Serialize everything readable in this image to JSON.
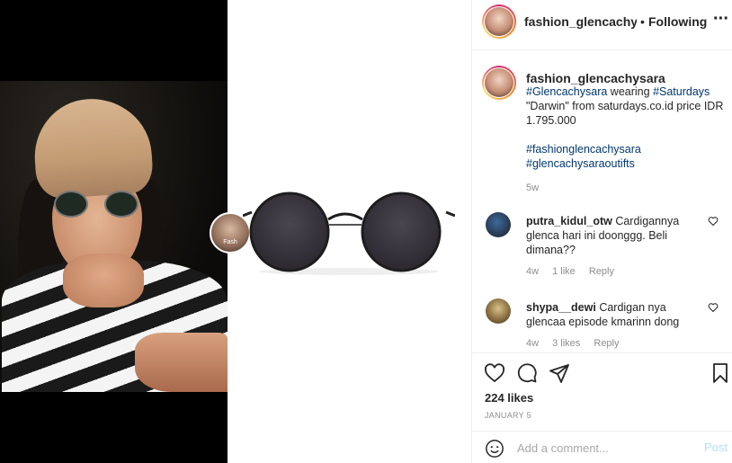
{
  "post": {
    "username": "fashion_glencachysara",
    "header_username": "fashion_glencachysara",
    "separator": "•",
    "follow_label": "Following",
    "more_label": "···",
    "tag_label": "Fash"
  },
  "caption": {
    "username": "fashion_glencachysara",
    "tag1": "#Glencachysara",
    "text1": " wearing ",
    "tag2": "#Saturdays",
    "text2": " \"Darwin\" from saturdays.co.id price IDR 1.795.000",
    "tag3": "#fashionglencachysara",
    "tag4": "#glencachysaraoutifts",
    "age": "5w"
  },
  "comments": [
    {
      "username": "putra_kidul_otw",
      "text": "Cardigannya glenca hari ini doonggg. Beli dimana??",
      "age": "4w",
      "likes": "1 like",
      "reply": "Reply"
    },
    {
      "username": "shypa__dewi",
      "text": "Cardigan nya glencaa episode kmarinn dong",
      "age": "4w",
      "likes": "3 likes",
      "reply": "Reply"
    }
  ],
  "actions": {
    "likes": "224 likes",
    "date": "JANUARY 5"
  },
  "add_comment": {
    "placeholder": "Add a comment...",
    "post_label": "Post"
  },
  "colors": {
    "link": "#00376b",
    "muted": "#8e8e8e",
    "post_disabled": "#b2dffc"
  }
}
